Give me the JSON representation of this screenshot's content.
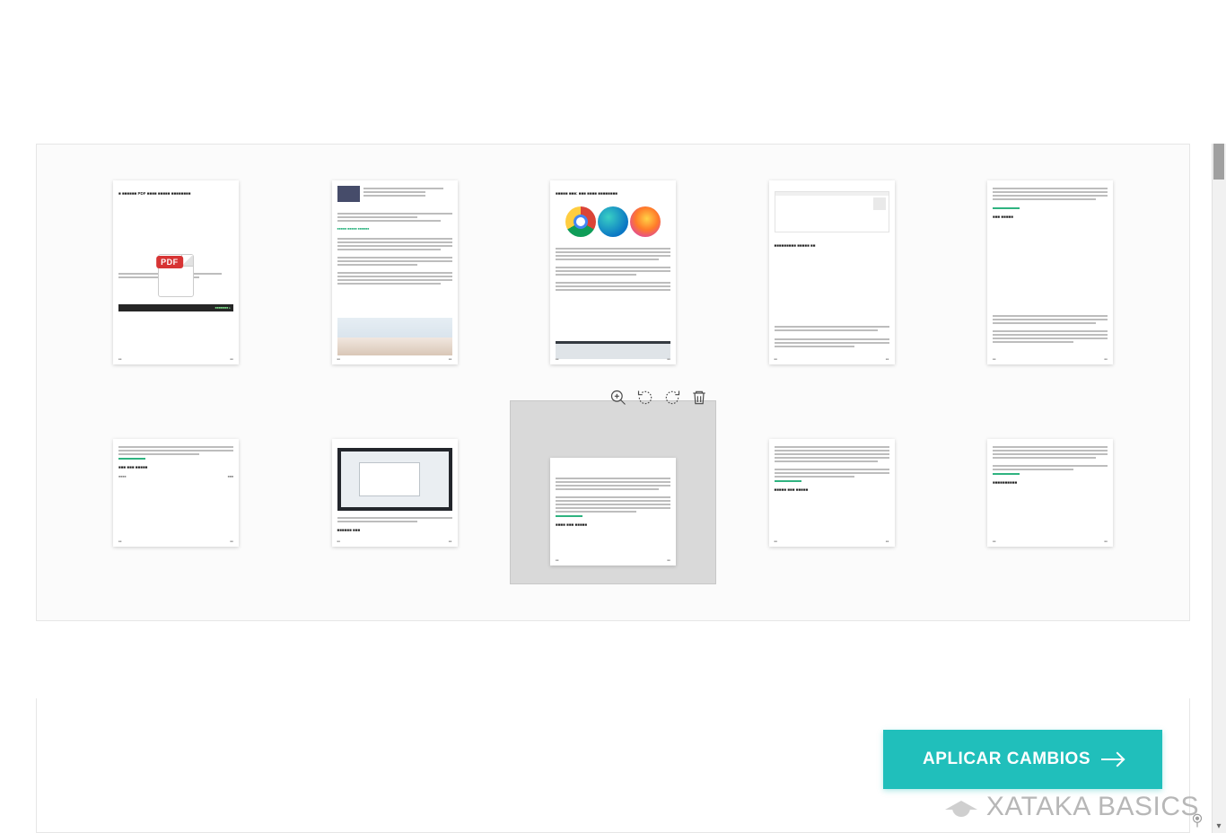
{
  "action_button": {
    "label": "APLICAR CAMBIOS"
  },
  "watermark": {
    "text": "XATAKA BASICS"
  },
  "toolbar": {
    "zoom": "zoom-in",
    "rotate_ccw": "rotate-ccw",
    "rotate_cw": "rotate-cw",
    "delete": "delete"
  },
  "pages": [
    {
      "num": 1,
      "selected": false,
      "kind": "pdf-cover"
    },
    {
      "num": 2,
      "selected": false,
      "kind": "article-photo"
    },
    {
      "num": 3,
      "selected": false,
      "kind": "browsers"
    },
    {
      "num": 4,
      "selected": false,
      "kind": "panel-text"
    },
    {
      "num": 5,
      "selected": false,
      "kind": "text-green"
    },
    {
      "num": 6,
      "selected": false,
      "kind": "text-short"
    },
    {
      "num": 7,
      "selected": false,
      "kind": "screenshot-dark"
    },
    {
      "num": 8,
      "selected": true,
      "kind": "text-para-green"
    },
    {
      "num": 9,
      "selected": false,
      "kind": "text-para-green2"
    },
    {
      "num": 10,
      "selected": false,
      "kind": "text-para-green3"
    }
  ]
}
